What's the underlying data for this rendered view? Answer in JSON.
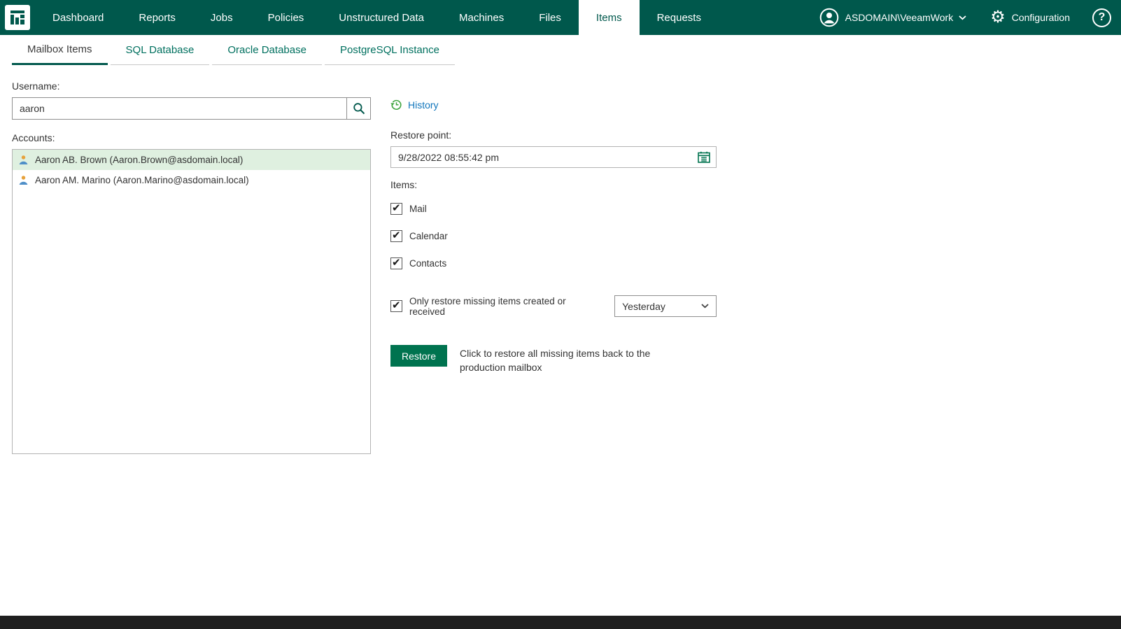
{
  "header": {
    "nav": [
      {
        "label": "Dashboard",
        "active": false
      },
      {
        "label": "Reports",
        "active": false
      },
      {
        "label": "Jobs",
        "active": false
      },
      {
        "label": "Policies",
        "active": false
      },
      {
        "label": "Unstructured Data",
        "active": false
      },
      {
        "label": "Machines",
        "active": false
      },
      {
        "label": "Files",
        "active": false
      },
      {
        "label": "Items",
        "active": true
      },
      {
        "label": "Requests",
        "active": false
      }
    ],
    "user": {
      "label": "ASDOMAIN\\VeeamWork"
    },
    "configuration_label": "Configuration",
    "help_label": "?"
  },
  "tabs": [
    {
      "label": "Mailbox Items",
      "active": true
    },
    {
      "label": "SQL Database",
      "active": false
    },
    {
      "label": "Oracle Database",
      "active": false
    },
    {
      "label": "PostgreSQL Instance",
      "active": false
    }
  ],
  "search": {
    "label": "Username:",
    "value": "aaron"
  },
  "accounts": {
    "label": "Accounts:",
    "items": [
      {
        "name": "Aaron AB. Brown (Aaron.Brown@asdomain.local)",
        "selected": true
      },
      {
        "name": "Aaron AM. Marino (Aaron.Marino@asdomain.local)",
        "selected": false
      }
    ]
  },
  "restore": {
    "history_label": "History",
    "restore_point_label": "Restore point:",
    "restore_point_value": "9/28/2022 08:55:42 pm",
    "items_label": "Items:",
    "item_checkboxes": [
      {
        "label": "Mail",
        "checked": true
      },
      {
        "label": "Calendar",
        "checked": true
      },
      {
        "label": "Contacts",
        "checked": true
      }
    ],
    "only_missing": {
      "label": "Only restore missing items created or received",
      "checked": true,
      "period": "Yesterday"
    },
    "restore_button": "Restore",
    "restore_hint": "Click to restore all missing items back to the production mailbox"
  },
  "icons": {
    "logo": "veeam-grid-logo",
    "user": "user-avatar-icon",
    "chevron": "chevron-down-icon",
    "gear": "gear-icon",
    "help": "help-icon",
    "search": "search-icon",
    "person": "person-icon",
    "history": "history-icon",
    "calendar": "calendar-icon"
  },
  "colors": {
    "header_bg": "#00584C",
    "accent_green": "#00734F",
    "selected_row": "#dff0e0",
    "link_blue": "#1176BC"
  }
}
